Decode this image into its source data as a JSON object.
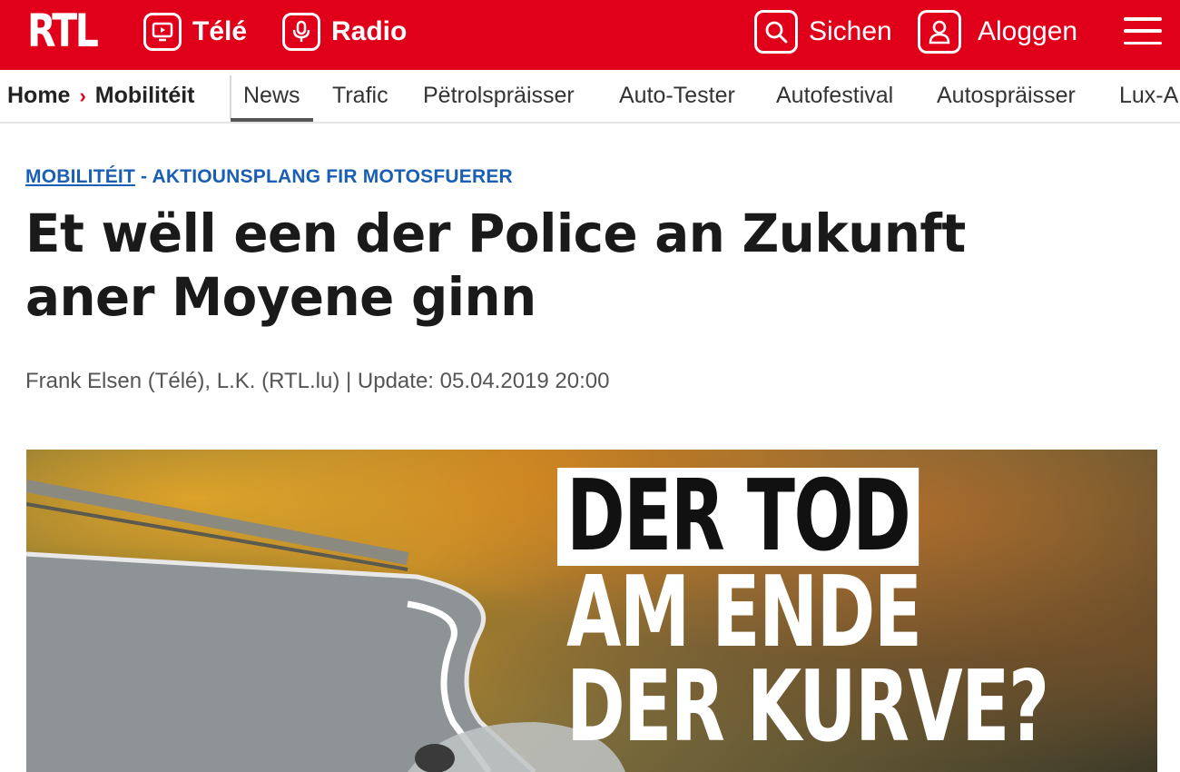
{
  "header": {
    "logo": "RTL",
    "nav": [
      {
        "label": "Télé",
        "icon": "tv-icon"
      },
      {
        "label": "Radio",
        "icon": "microphone-icon"
      }
    ],
    "search_label": "Sichen",
    "login_label": "Aloggen",
    "brand_color": "#e1001a"
  },
  "subnav": {
    "breadcrumb": [
      "Home",
      "Mobilitéit"
    ],
    "breadcrumb_separator": "›",
    "tabs": [
      "News",
      "Trafic",
      "Pëtrolspräisser",
      "Auto-Tester",
      "Autofestival",
      "Autospräisser",
      "Lux-A"
    ],
    "active_tab": "News"
  },
  "article": {
    "category": "MOBILITÉIT",
    "kicker_rest": " - AKTIOUNSPLANG FIR MOTOSFUERER",
    "headline": "Et wëll een der Police an Zukunft aner Moyene ginn",
    "byline": "Frank Elsen (Télé), L.K. (RTL.lu) | Update: 05.04.2019 20:00",
    "kicker_color": "#1a5fb4"
  },
  "hero": {
    "lines": [
      "DER TOD",
      "AM ENDE",
      "DER KURVE?"
    ]
  }
}
